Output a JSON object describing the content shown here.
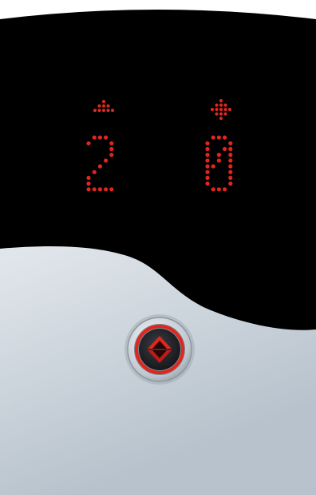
{
  "panel": {
    "display_left": {
      "digit": "2",
      "arrow": "up-arrow-icon"
    },
    "display_right": {
      "digit": "0",
      "arrow": "up-down-arrow-icon"
    },
    "call_button": {
      "icon": "up-down-arrows-icon",
      "lit": true
    }
  },
  "colors": {
    "led": "#e0261e",
    "display_bg": "#000000",
    "button_ring": "#d82a22",
    "steel_light": "#f2f4f6",
    "steel_dark": "#b9c3cc"
  }
}
